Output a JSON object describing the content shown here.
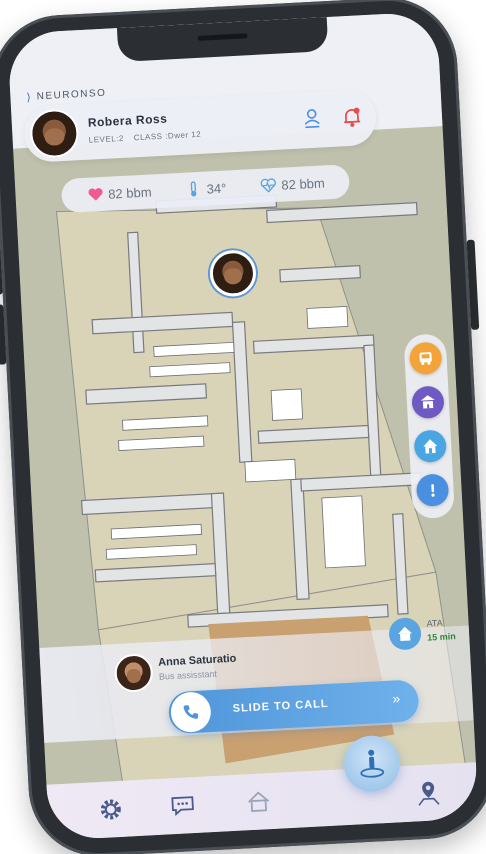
{
  "app": {
    "brand": "NEURONSO"
  },
  "user": {
    "name": "Robera Ross",
    "level": "LEVEL:2",
    "class": "CLASS :Dwer 12"
  },
  "vitals": [
    {
      "icon": "heart-icon",
      "value": "82 bbm",
      "color": "#ef5a94"
    },
    {
      "icon": "thermometer-icon",
      "value": "34°",
      "color": "#5aa4e0"
    },
    {
      "icon": "heart-pulse-icon",
      "value": "82 bbm",
      "color": "#5aa4e0"
    }
  ],
  "quick_actions": [
    {
      "name": "bus",
      "icon": "bus-icon",
      "color": "#f2a43a"
    },
    {
      "name": "school",
      "icon": "school-icon",
      "color": "#6e5ac2"
    },
    {
      "name": "home",
      "icon": "home-icon",
      "color": "#4aa6e3"
    },
    {
      "name": "info",
      "icon": "info-icon",
      "color": "#4a8fe0"
    }
  ],
  "contact": {
    "name": "Anna Saturatio",
    "role": "Bus assisstant"
  },
  "eta": {
    "label": "ATA",
    "time": "15 min"
  },
  "call": {
    "label": "SLIDE TO CALL",
    "arrows": "»"
  },
  "nav": [
    {
      "name": "settings",
      "icon": "gear-icon"
    },
    {
      "name": "chat",
      "icon": "chat-icon"
    },
    {
      "name": "home",
      "icon": "home-icon"
    },
    {
      "name": "locate",
      "icon": "person-location-icon"
    },
    {
      "name": "map",
      "icon": "map-pin-icon"
    }
  ],
  "colors": {
    "accent": "#5aa4e0",
    "alert": "#e84b4b",
    "heart": "#ef5a94",
    "eta_green": "#2a8a3a"
  }
}
